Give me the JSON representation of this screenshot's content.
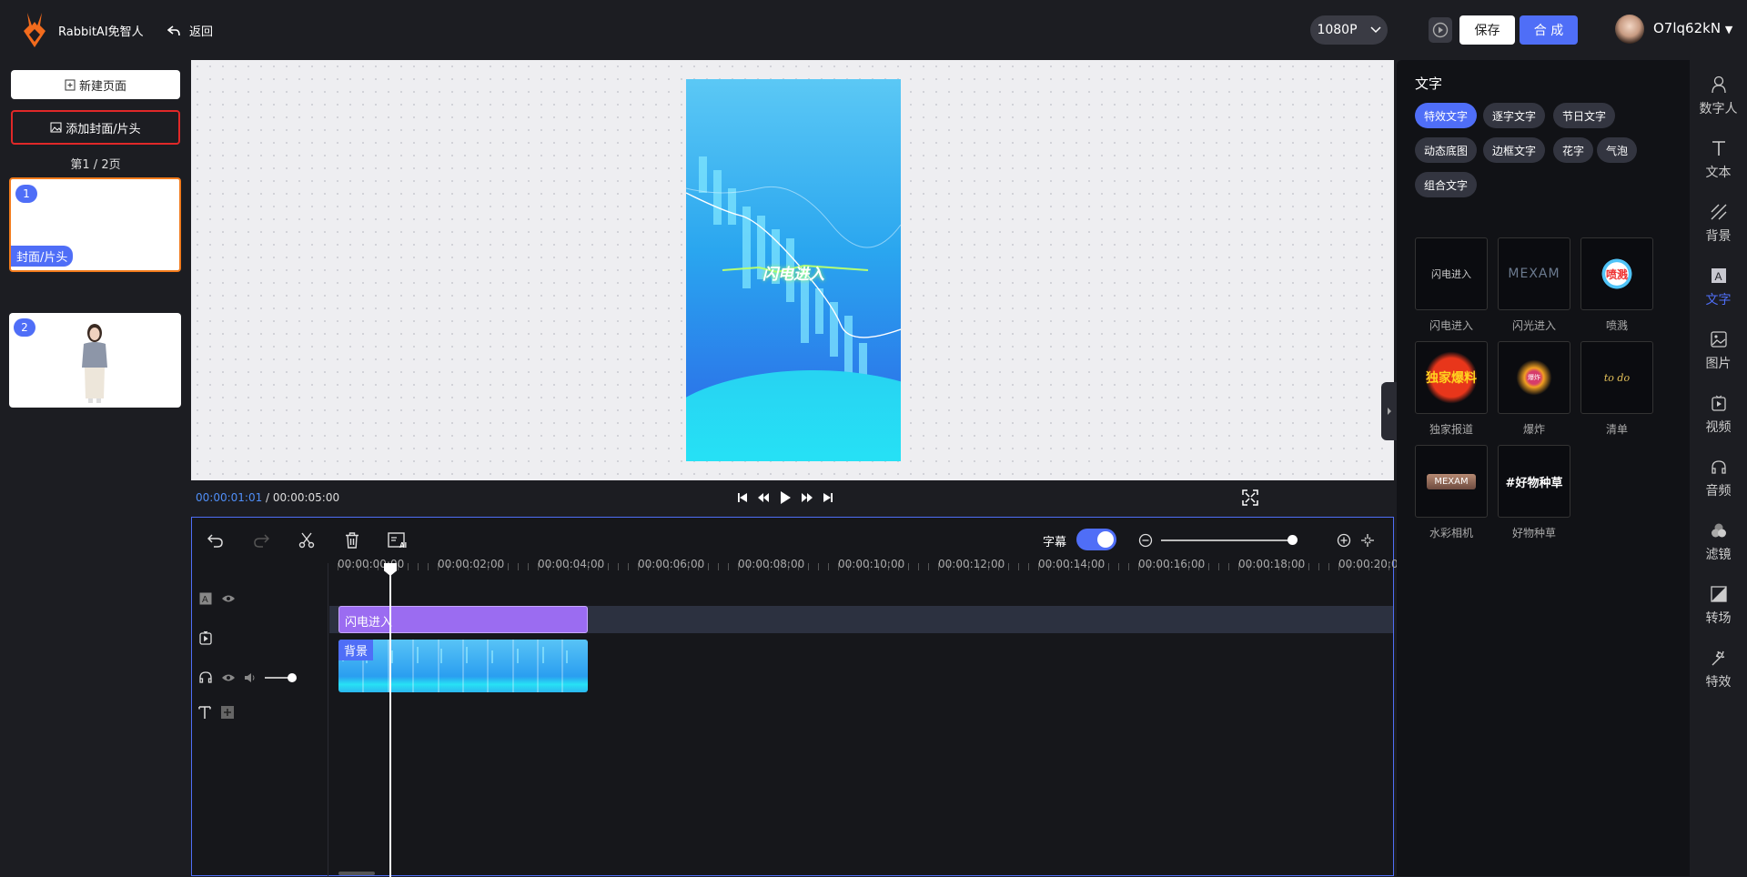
{
  "app": {
    "name": "RabbitAI免智人",
    "back_label": "返回"
  },
  "header": {
    "resolution": "1080P",
    "save_label": "保存",
    "compose_label": "合 成",
    "username": "O7lq62kN"
  },
  "left": {
    "new_page_label": "新建页面",
    "add_cover_label": "添加封面/片头",
    "page_count": "第1 / 2页",
    "pages": [
      {
        "num": "1",
        "tag": "封面/片头"
      },
      {
        "num": "2",
        "tag": ""
      }
    ]
  },
  "canvas": {
    "video_title": "闪电进入"
  },
  "player": {
    "current_time": "00:00:01:01",
    "separator": " / ",
    "total_time": "00:00:05:00"
  },
  "timeline": {
    "subtitle_label": "字幕",
    "subtitle_enabled": true,
    "ticks": [
      "00:00:00:00",
      "00:00:02:00",
      "00:00:04:00",
      "00:00:06:00",
      "00:00:08:00",
      "00:00:10:00",
      "00:00:12:00",
      "00:00:14:00",
      "00:00:16:00",
      "00:00:18:00",
      "00:00:20:00"
    ],
    "text_clip_label": "闪电进入",
    "bg_clip_label": "背景"
  },
  "panel": {
    "title": "文字",
    "categories": [
      "特效文字",
      "逐字文字",
      "节日文字",
      "动态底图",
      "边框文字",
      "花字",
      "气泡",
      "组合文字"
    ],
    "active_category": "特效文字",
    "items": [
      {
        "label": "闪电进入",
        "preview": "闪电进入"
      },
      {
        "label": "闪光进入",
        "preview": "MEXAM"
      },
      {
        "label": "喷溅",
        "preview": "喷溅"
      },
      {
        "label": "独家报道",
        "preview": "独家爆料"
      },
      {
        "label": "爆炸",
        "preview": "爆炸"
      },
      {
        "label": "清单",
        "preview": "to do"
      },
      {
        "label": "水彩相机",
        "preview": "MEXAM"
      },
      {
        "label": "好物种草",
        "preview": "#好物种草"
      }
    ]
  },
  "nav": {
    "items": [
      "数字人",
      "文本",
      "背景",
      "文字",
      "图片",
      "视频",
      "音频",
      "滤镜",
      "转场",
      "特效"
    ],
    "active": "文字"
  },
  "colors": {
    "accent": "#4f6ef7",
    "selected_border": "#f27b1c",
    "cover_highlight": "#e02828",
    "text_clip": "#9b6cf1"
  }
}
